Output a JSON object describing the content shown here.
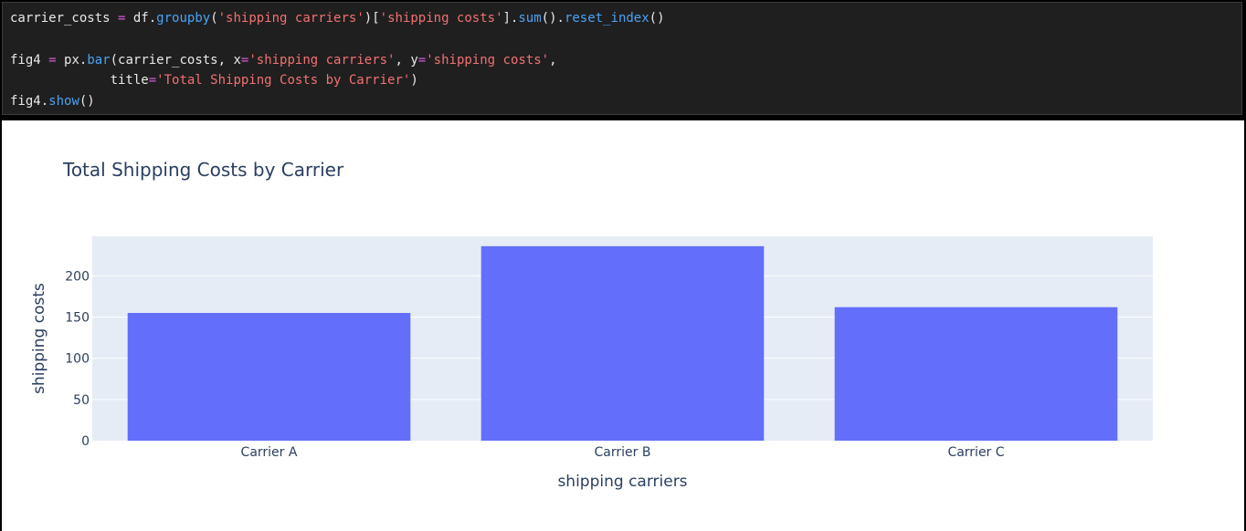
{
  "code": {
    "lines": [
      [
        {
          "t": "carrier_costs ",
          "c": "plain"
        },
        {
          "t": "=",
          "c": "op"
        },
        {
          "t": " df.",
          "c": "plain"
        },
        {
          "t": "groupby",
          "c": "fn"
        },
        {
          "t": "(",
          "c": "plain"
        },
        {
          "t": "'shipping carriers'",
          "c": "str"
        },
        {
          "t": ")[",
          "c": "plain"
        },
        {
          "t": "'shipping costs'",
          "c": "str"
        },
        {
          "t": "].",
          "c": "plain"
        },
        {
          "t": "sum",
          "c": "fn"
        },
        {
          "t": "().",
          "c": "plain"
        },
        {
          "t": "reset_index",
          "c": "fn"
        },
        {
          "t": "()",
          "c": "plain"
        }
      ],
      [],
      [
        {
          "t": "fig4 ",
          "c": "plain"
        },
        {
          "t": "=",
          "c": "op"
        },
        {
          "t": " px.",
          "c": "plain"
        },
        {
          "t": "bar",
          "c": "fn"
        },
        {
          "t": "(carrier_costs, x",
          "c": "plain"
        },
        {
          "t": "=",
          "c": "op"
        },
        {
          "t": "'shipping carriers'",
          "c": "str"
        },
        {
          "t": ", y",
          "c": "plain"
        },
        {
          "t": "=",
          "c": "op"
        },
        {
          "t": "'shipping costs'",
          "c": "str"
        },
        {
          "t": ",",
          "c": "plain"
        }
      ],
      [
        {
          "t": "             title",
          "c": "plain"
        },
        {
          "t": "=",
          "c": "op"
        },
        {
          "t": "'Total Shipping Costs by Carrier'",
          "c": "str"
        },
        {
          "t": ")",
          "c": "plain"
        }
      ],
      [
        {
          "t": "fig4.",
          "c": "plain"
        },
        {
          "t": "show",
          "c": "fn"
        },
        {
          "t": "()",
          "c": "plain"
        }
      ]
    ]
  },
  "chart_data": {
    "type": "bar",
    "title": "Total Shipping Costs by Carrier",
    "xlabel": "shipping carriers",
    "ylabel": "shipping costs",
    "categories": [
      "Carrier A",
      "Carrier B",
      "Carrier C"
    ],
    "values": [
      155,
      236,
      162
    ],
    "ylim": [
      0,
      248
    ],
    "yticks": [
      0,
      50,
      100,
      150,
      200
    ],
    "grid": true,
    "colors": {
      "bar": "#636efa",
      "plot_bg": "#e5ecf6",
      "grid": "#ffffff",
      "text": "#2a3f5f"
    }
  }
}
